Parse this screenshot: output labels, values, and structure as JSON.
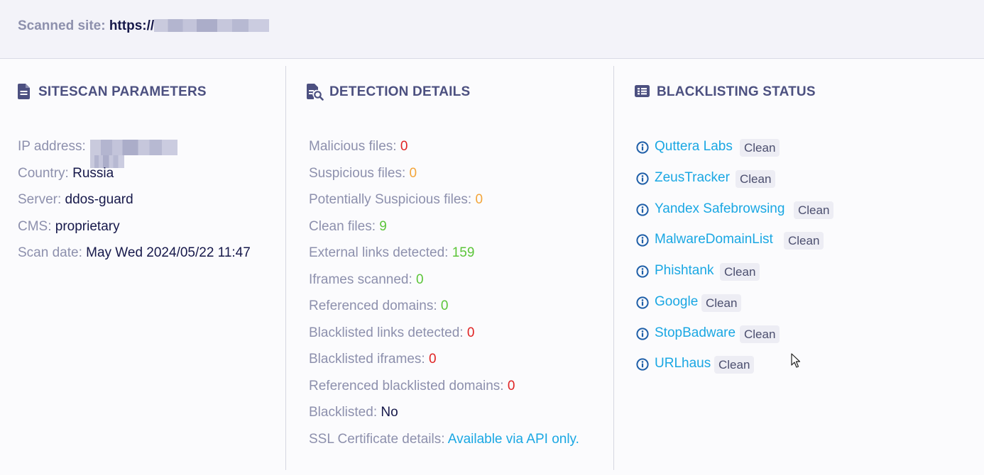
{
  "header": {
    "scanned_label": "Scanned site:",
    "url_prefix": "https://"
  },
  "sitescan": {
    "title": "SITESCAN PARAMETERS",
    "icon": "document-icon",
    "ip_label": "IP address:",
    "country_label": "Country:",
    "country_value": "Russia",
    "server_label": "Server:",
    "server_value": "ddos-guard",
    "cms_label": "CMS:",
    "cms_value": "proprietary",
    "scan_date_label": "Scan date:",
    "scan_date_value": "May Wed 2024/05/22 11:47"
  },
  "detection": {
    "title": "DETECTION DETAILS",
    "icon": "file-search-icon",
    "rows": [
      {
        "label": "Malicious files:",
        "value": "0",
        "color": "#e02424"
      },
      {
        "label": "Suspicious files:",
        "value": "0",
        "color": "#f3a53a"
      },
      {
        "label": "Potentially Suspicious files:",
        "value": "0",
        "color": "#f3a53a"
      },
      {
        "label": "Clean files:",
        "value": "9",
        "color": "#5cc53a"
      },
      {
        "label": "External links detected:",
        "value": "159",
        "color": "#5cc53a"
      },
      {
        "label": "Iframes scanned:",
        "value": "0",
        "color": "#5cc53a"
      },
      {
        "label": "Referenced domains:",
        "value": "0",
        "color": "#5cc53a"
      },
      {
        "label": "Blacklisted links detected:",
        "value": "0",
        "color": "#e02424"
      },
      {
        "label": "Blacklisted iframes:",
        "value": "0",
        "color": "#e02424"
      },
      {
        "label": "Referenced blacklisted domains:",
        "value": "0",
        "color": "#e02424"
      },
      {
        "label": "Blacklisted:",
        "value": "No",
        "color": "#16184a"
      },
      {
        "label": "SSL Certificate details:",
        "value": "Available via API only.",
        "color": "#1aa7e3"
      }
    ]
  },
  "blacklisting": {
    "title": "BLACKLISTING STATUS",
    "icon": "list-card-icon",
    "items": [
      {
        "name": "Quttera Labs",
        "status": "Clean"
      },
      {
        "name": "ZeusTracker",
        "status": "Clean"
      },
      {
        "name": "Yandex Safebrowsing",
        "status": "Clean"
      },
      {
        "name": "MalwareDomainList",
        "status": "Clean"
      },
      {
        "name": "Phishtank",
        "status": "Clean"
      },
      {
        "name": "Google",
        "status": "Clean"
      },
      {
        "name": "StopBadware",
        "status": "Clean"
      },
      {
        "name": "URLhaus",
        "status": "Clean"
      }
    ]
  },
  "colors": {
    "label": "#8d90ad",
    "value": "#16184a",
    "heading": "#4c5080",
    "link": "#1aa7e3",
    "danger": "#e02424",
    "warning": "#f3a53a",
    "ok": "#5cc53a"
  }
}
